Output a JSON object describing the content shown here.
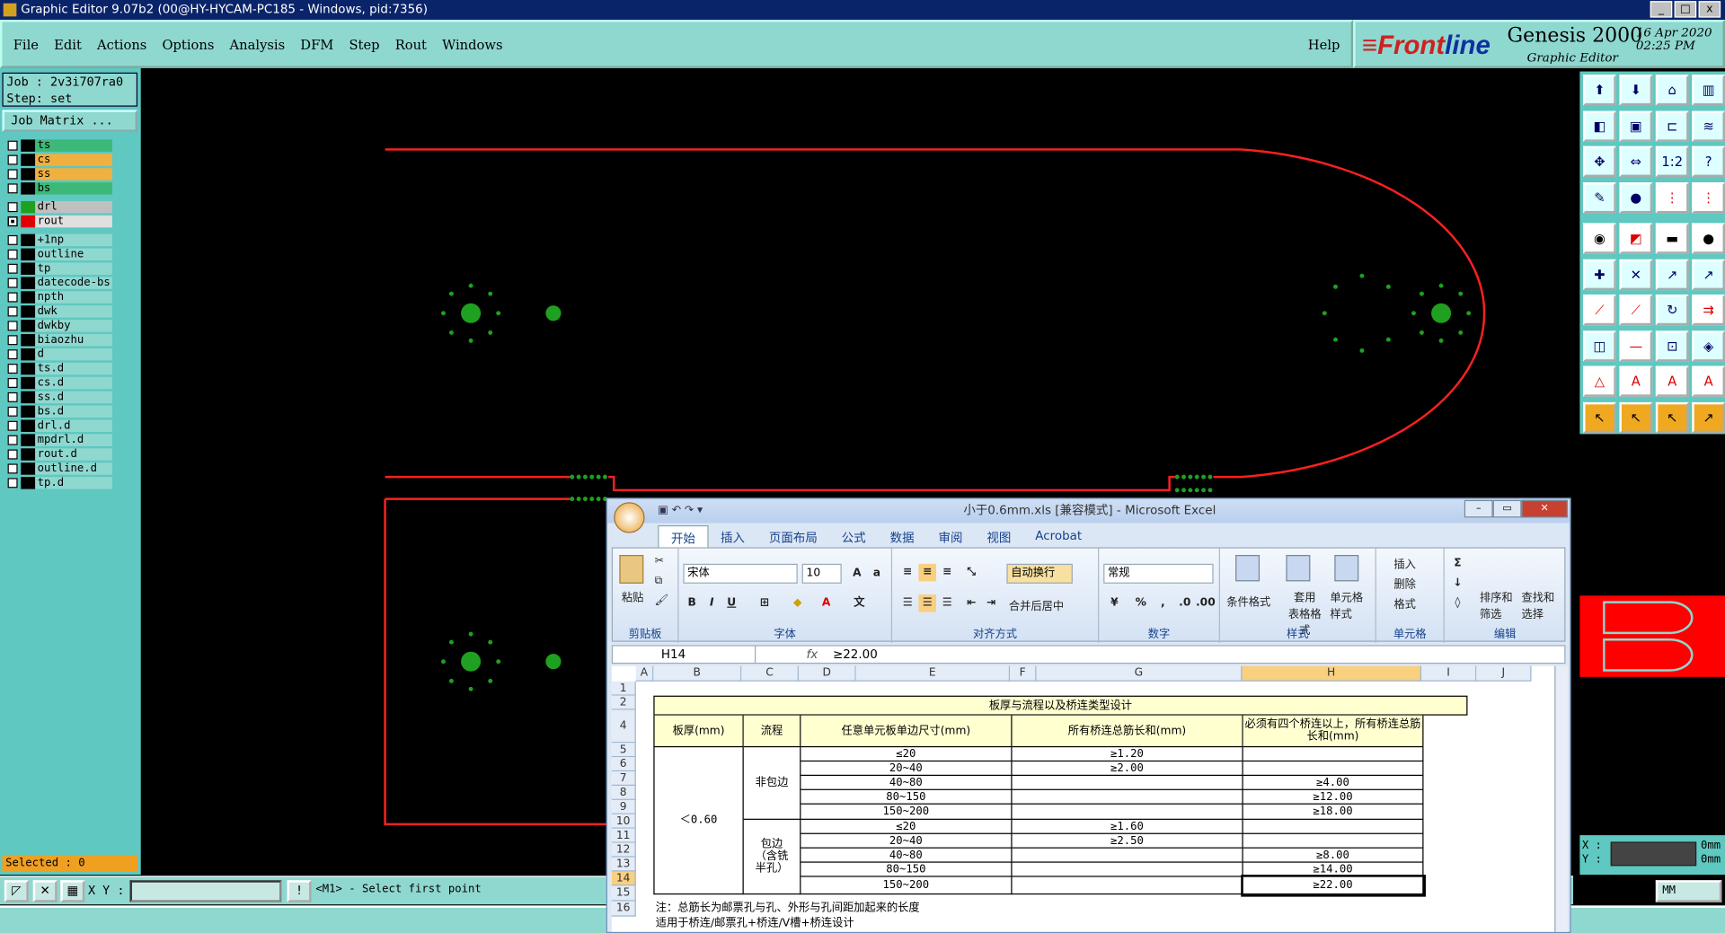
{
  "window": {
    "title": "Graphic Editor 9.07b2 (00@HY-HYCAM-PC185 - Windows, pid:7356)",
    "min": "_",
    "max": "□",
    "close": "x"
  },
  "menu": {
    "items": [
      "File",
      "Edit",
      "Actions",
      "Options",
      "Analysis",
      "DFM",
      "Step",
      "Rout",
      "Windows"
    ],
    "help": "Help"
  },
  "brand": {
    "logo_a": "≡Front",
    "logo_b": "line",
    "product": "Genesis 2000",
    "subtitle": "Graphic Editor",
    "date": "16 Apr 2020",
    "time": "02:25 PM"
  },
  "job": {
    "job_line": "Job : 2v3i707ra0",
    "step_line": "Step: set",
    "matrix_button": "Job Matrix ..."
  },
  "layers": [
    {
      "name": "ts",
      "bg": "#3cb878",
      "sw": "#000",
      "on": false,
      "gap": false
    },
    {
      "name": "cs",
      "bg": "#f0b040",
      "sw": "#000",
      "on": false,
      "gap": false
    },
    {
      "name": "ss",
      "bg": "#f0b040",
      "sw": "#000",
      "on": false,
      "gap": false
    },
    {
      "name": "bs",
      "bg": "#3cb878",
      "sw": "#000",
      "on": false,
      "gap": true
    },
    {
      "name": "drl",
      "bg": "#c0c0c0",
      "sw": "#20a020",
      "on": false,
      "gap": false
    },
    {
      "name": "rout",
      "bg": "#e0e0e0",
      "sw": "#e00000",
      "on": true,
      "gap": true
    },
    {
      "name": "+1np",
      "bg": "#8fd8d0",
      "sw": "#000",
      "on": false,
      "gap": false
    },
    {
      "name": "outline",
      "bg": "#8fd8d0",
      "sw": "#000",
      "on": false,
      "gap": false
    },
    {
      "name": "tp",
      "bg": "#8fd8d0",
      "sw": "#000",
      "on": false,
      "gap": false
    },
    {
      "name": "datecode-bs",
      "bg": "#8fd8d0",
      "sw": "#000",
      "on": false,
      "gap": false
    },
    {
      "name": "npth",
      "bg": "#8fd8d0",
      "sw": "#000",
      "on": false,
      "gap": false
    },
    {
      "name": "dwk",
      "bg": "#8fd8d0",
      "sw": "#000",
      "on": false,
      "gap": false
    },
    {
      "name": "dwkby",
      "bg": "#8fd8d0",
      "sw": "#000",
      "on": false,
      "gap": false
    },
    {
      "name": "biaozhu",
      "bg": "#8fd8d0",
      "sw": "#000",
      "on": false,
      "gap": false
    },
    {
      "name": "d",
      "bg": "#8fd8d0",
      "sw": "#000",
      "on": false,
      "gap": false
    },
    {
      "name": "ts.d",
      "bg": "#8fd8d0",
      "sw": "#000",
      "on": false,
      "gap": false
    },
    {
      "name": "cs.d",
      "bg": "#8fd8d0",
      "sw": "#000",
      "on": false,
      "gap": false
    },
    {
      "name": "ss.d",
      "bg": "#8fd8d0",
      "sw": "#000",
      "on": false,
      "gap": false
    },
    {
      "name": "bs.d",
      "bg": "#8fd8d0",
      "sw": "#000",
      "on": false,
      "gap": false
    },
    {
      "name": "drl.d",
      "bg": "#8fd8d0",
      "sw": "#000",
      "on": false,
      "gap": false
    },
    {
      "name": "mpdrl.d",
      "bg": "#8fd8d0",
      "sw": "#000",
      "on": false,
      "gap": false
    },
    {
      "name": "rout.d",
      "bg": "#8fd8d0",
      "sw": "#000",
      "on": false,
      "gap": false
    },
    {
      "name": "outline.d",
      "bg": "#8fd8d0",
      "sw": "#000",
      "on": false,
      "gap": false
    },
    {
      "name": "tp.d",
      "bg": "#8fd8d0",
      "sw": "#000",
      "on": false,
      "gap": false
    }
  ],
  "selected": "Selected : 0",
  "bottom": {
    "xy_label": "X Y :",
    "prompt": "<M1> - Select first point"
  },
  "coords": {
    "x_label": "X :",
    "y_label": "Y :",
    "x_value": "",
    "y_value": "",
    "unit_x": "0mm",
    "unit_y": "0mm",
    "unit_button": "MM"
  },
  "colors": {
    "outline": "#ff2020",
    "pad": "#20a020",
    "panel": "#8fd8d0"
  },
  "excel": {
    "title": "小于0.6mm.xls [兼容模式] - Microsoft Excel",
    "tabs": [
      "开始",
      "插入",
      "页面布局",
      "公式",
      "数据",
      "审阅",
      "视图",
      "Acrobat"
    ],
    "ribbon": {
      "paste": "粘贴",
      "clipboard": "剪贴板",
      "font_name": "宋体",
      "font_size": "10",
      "font": "字体",
      "wrap": "自动换行",
      "merge": "合并后居中",
      "alignment": "对齐方式",
      "number_format": "常规",
      "number": "数字",
      "cond": "条件格式",
      "table": "套用",
      "table2": "表格格式",
      "cellstyle": "单元格",
      "cellstyle2": "样式",
      "styles": "样式",
      "insert": "插入",
      "delete": "删除",
      "format": "格式",
      "cells": "单元格",
      "sort": "排序和",
      "sort2": "筛选",
      "find": "查找和",
      "find2": "选择",
      "editing": "编辑"
    },
    "namebox": "H14",
    "fx": "fx",
    "formula": "≥22.00",
    "cols": [
      "A",
      "B",
      "C",
      "D",
      "E",
      "F",
      "G",
      "H",
      "I",
      "J"
    ],
    "rows": [
      "1",
      "2",
      "4",
      "5",
      "6",
      "7",
      "8",
      "9",
      "10",
      "11",
      "12",
      "13",
      "14",
      "15",
      "16"
    ],
    "table": {
      "title": "板厚与流程以及桥连类型设计",
      "headers": [
        "板厚(mm)",
        "流程",
        "任意单元板单边尺寸(mm)",
        "所有桥连总筋长和(mm)",
        "必须有四个桥连以上，所有桥连总筋长和(mm)"
      ],
      "thickness": "＜0.60",
      "process1": "非包边",
      "process2": "包边（含铣半孔）",
      "sizes": [
        "≤20",
        "20~40",
        "40~80",
        "80~150",
        "150~200",
        "≤20",
        "20~40",
        "40~80",
        "80~150",
        "150~200"
      ],
      "total": [
        "≥1.20",
        "≥2.00",
        "",
        "",
        "",
        "≥1.60",
        "≥2.50",
        "",
        "",
        ""
      ],
      "four": [
        "",
        "",
        "≥4.00",
        "≥12.00",
        "≥18.00",
        "",
        "",
        "≥8.00",
        "≥14.00",
        "≥22.00"
      ],
      "note1": "注：总筋长为邮票孔与孔、外形与孔间距加起来的长度",
      "note2": "适用于桥连/邮票孔+桥连/V槽+桥连设计"
    }
  }
}
